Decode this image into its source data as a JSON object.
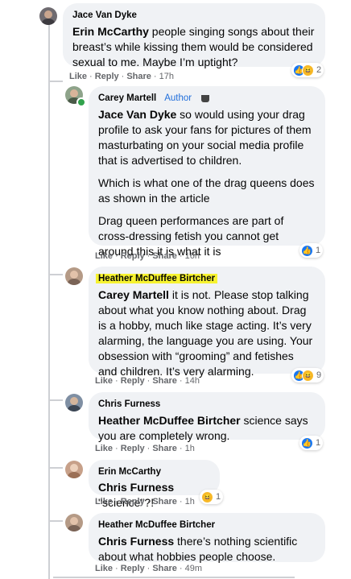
{
  "comments": [
    {
      "author": "Jace Van Dyke",
      "mention": "Erin McCarthy",
      "text": " people singing songs about their breast’s while kissing them would be considered sexual to me. Maybe I’m uptight?",
      "actions": {
        "like": "Like",
        "reply": "Reply",
        "share": "Share",
        "time": "17h"
      },
      "reaction_count": "2"
    },
    {
      "author": "Carey Martell",
      "badge": "Author",
      "mention": "Jace Van Dyke",
      "text": " so would using your drag profile to ask your fans for pictures of them masturbating on your social media profile that is advertised to children.",
      "text2": "Which is what one of the drag queens does as shown in the article",
      "text3": "Drag queen performances are part of cross-dressing fetish you cannot get around this it is what it is",
      "actions": {
        "like": "Like",
        "reply": "Reply",
        "share": "Share",
        "time": "16h"
      },
      "reaction_count": "1"
    },
    {
      "author": "Heather McDuffee Birtcher",
      "mention": "Carey Martell",
      "text": " it is not. Please stop talking about what you know nothing about. Drag is a hobby, much like stage acting. It’s very alarming, the language you are using. Your obsession with “grooming” and fetishes and children. It’s very alarming.",
      "actions": {
        "like": "Like",
        "reply": "Reply",
        "share": "Share",
        "time": "14h"
      },
      "reaction_count": "9"
    },
    {
      "author": "Chris Furness",
      "mention": "Heather McDuffee Birtcher",
      "text": " science says you are completely wrong.",
      "actions": {
        "like": "Like",
        "reply": "Reply",
        "share": "Share",
        "time": "1h"
      },
      "reaction_count": "1"
    },
    {
      "author": "Erin McCarthy",
      "mention": "Chris Furness",
      "text": " \"science\"?!",
      "actions": {
        "like": "Like",
        "reply": "Reply",
        "share": "Share",
        "time": "1h"
      },
      "reaction_count": "1"
    },
    {
      "author": "Heather McDuffee Birtcher",
      "mention": "Chris Furness",
      "text": " there’s nothing scientific about what hobbies people choose.",
      "actions": {
        "like": "Like",
        "reply": "Reply",
        "share": "Share",
        "time": "49m"
      }
    }
  ],
  "icons": {
    "like": "like-reaction-icon",
    "haha": "haha-reaction-icon",
    "cup": "coffee-cup-icon",
    "online": "online-status-icon"
  },
  "colors": {
    "bubble": "#f0f2f5",
    "highlight": "#f7f331",
    "like_blue": "#1877f2",
    "author_badge": "#216fdb",
    "thread_line": "#ced0d4"
  }
}
